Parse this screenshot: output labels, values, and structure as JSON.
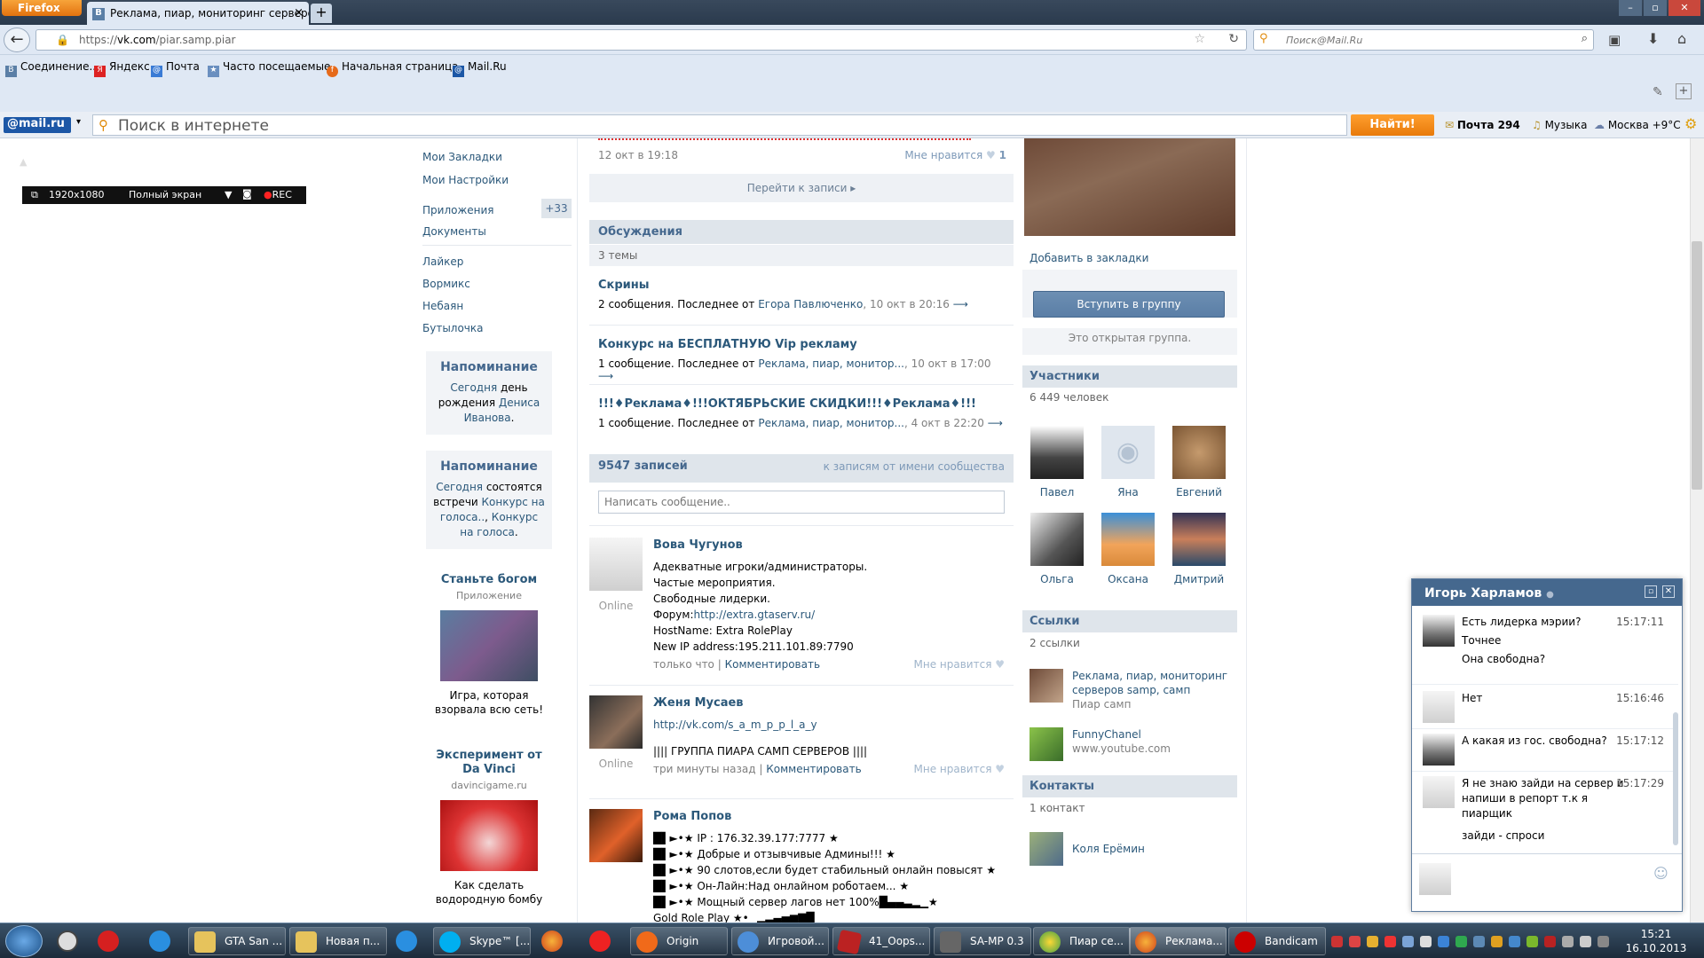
{
  "browser": {
    "menu_button": "Firefox",
    "tab_title": "Реклама, пиар, мониторинг серверов ...",
    "tab_favicon": "В",
    "url_prefix": "https://",
    "url_host": "vk.com",
    "url_path": "/piar.samp.piar",
    "search_placeholder": "Поиск@Mail.Ru",
    "bookmarks": [
      "Соединение...",
      "Яндекс",
      "Почта",
      "Часто посещаемые",
      "Начальная страница",
      "Mail.Ru"
    ]
  },
  "mailru_bar": {
    "logo": "@mail.ru",
    "search_placeholder": "Поиск в интернете",
    "find_button": "Найти!",
    "mail": "Почта 294",
    "music": "Музыка",
    "weather": "Москва +9°C"
  },
  "recorder": {
    "resolution": "1920x1080",
    "mode": "Полный экран",
    "rec": "REC"
  },
  "left_menu": {
    "items": [
      "Мои Закладки",
      "Мои Настройки",
      "Приложения",
      "Документы",
      "Лайкер",
      "Вормикс",
      "Небаян",
      "Бутылочка"
    ],
    "apps_count": "+33",
    "reminder1": {
      "title": "Напоминание",
      "t1": "Сегодня",
      "t2": " день рождения ",
      "t3": "Дениса Иванова",
      "t4": "."
    },
    "reminder2": {
      "title": "Напоминание",
      "t1": "Сегодня",
      "t2": " состоятся встречи ",
      "t3": "Конкурс на голоса..",
      "t4": ", ",
      "t5": "Конкурс на голоса",
      "t6": "."
    },
    "ad1": {
      "title": "Станьте богом",
      "sub": "Приложение",
      "text": "Игра, которая взорвала всю сеть!"
    },
    "ad2": {
      "title": "Эксперимент от Da Vinci",
      "sub": "davincigame.ru",
      "text": "Как сделать водородную бомбу"
    }
  },
  "center": {
    "prev_post_date": "12 окт в 19:18",
    "prev_post_like": "Мне нравится",
    "prev_post_like_count": "1",
    "goto_post": "Перейти к записи",
    "discussions_title": "Обсуждения",
    "discussions_count": "3 темы",
    "topics": [
      {
        "title": "Скрины",
        "meta1": "2 сообщения. Последнее от ",
        "author": "Егора Павлюченко",
        "date": ", 10 окт в 20:16"
      },
      {
        "title": "Конкурс на БЕСПЛАТНУЮ Vip рекламу",
        "meta1": "1 сообщение. Последнее от ",
        "author": "Реклама, пиар, монитор...",
        "date": ", 10 окт в 17:00"
      },
      {
        "title": "!!!♦Реклама♦!!!ОКТЯБРЬСКИЕ СКИДКИ!!!♦Реклама♦!!!",
        "meta1": "1 сообщение. Последнее от ",
        "author": "Реклама, пиар, монитор...",
        "date": ", 4 окт в 22:20"
      }
    ],
    "wall_count": "9547 записей",
    "wall_filter": "к записям от имени сообщества",
    "wall_input_placeholder": "Написать сообщение..",
    "posts": [
      {
        "author": "Вова Чугунов",
        "status": "Online",
        "lines": [
          "Адекватные игроки/администраторы.",
          "Частые мероприятия.",
          "Свободные лидерки."
        ],
        "forum_label": "Форум:",
        "forum_link": "http://extra.gtaserv.ru/",
        "lines2": [
          "HostName: Extra RolePlay",
          "New IP address:195.211.101.89:7790"
        ],
        "time": "только что",
        "comment": "Комментировать",
        "like": "Мне нравится"
      },
      {
        "author": "Женя Мусаев",
        "status": "Online",
        "link": "http://vk.com/s_a_m_p_p_l_a_y",
        "lines": [
          "|||| ГРУППА ПИАРА САМП СЕРВЕРОВ ||||"
        ],
        "time": "три минуты назад",
        "comment": "Комментировать",
        "like": "Мне нравится"
      },
      {
        "author": "Рома Попов",
        "lines": [
          "█▌►•★ IP : 176.32.39.177:7777 ★",
          "█▌►•★ Добрые и отзывчивые Админы!!! ★",
          "█▌►•★ 90 слотов,если будет стабильный онлайн повысят ★",
          "█▌►•★ Он-Лайн:Над онлайном роботаем... ★",
          "█▌►•★ Мощный сервер лагов нет 100%█▄▄▃▂▁★",
          "Gold Role Play ★•▁▂▃▄▅▆▇█"
        ]
      }
    ]
  },
  "right": {
    "add_bookmark": "Добавить в закладки",
    "join_button": "Вступить в группу",
    "open_group": "Это открытая группа.",
    "members_title": "Участники",
    "members_count": "6 449 человек",
    "members": [
      "Павел",
      "Яна",
      "Евгений",
      "Ольга",
      "Оксана",
      "Дмитрий"
    ],
    "links_title": "Ссылки",
    "links_count": "2 ссылки",
    "links": [
      {
        "title": "Реклама, пиар, мониторинг серверов samp, самп",
        "sub": "Пиар самп"
      },
      {
        "title": "FunnyChanel",
        "sub": "www.youtube.com"
      }
    ],
    "contacts_title": "Контакты",
    "contacts_count": "1 контакт",
    "contact": "Коля Ерёмин"
  },
  "chat": {
    "name": "Игорь Харламов",
    "messages": [
      {
        "lines": [
          "Есть лидерка мэрии?",
          "Точнее",
          "Она свободна?"
        ],
        "time": "15:17:11"
      },
      {
        "lines": [
          "Нет"
        ],
        "time": "15:16:46"
      },
      {
        "lines": [
          "А какая из гос. свободна?"
        ],
        "time": "15:17:12"
      },
      {
        "lines": [
          "Я не знаю зайди на сервер и напиши в репорт т.к я пиарщик",
          "зайди - спроси"
        ],
        "time": "15:17:29"
      }
    ]
  },
  "taskbar": {
    "items": [
      "GTA San ...",
      "Новая п...",
      "Skype™ [...",
      "Origin",
      "Игровой...",
      "41_Oops...",
      "SA-MP 0.3",
      "Пиар се...",
      "Реклама...",
      "Bandicam"
    ],
    "time": "15:21",
    "date": "16.10.2013"
  }
}
